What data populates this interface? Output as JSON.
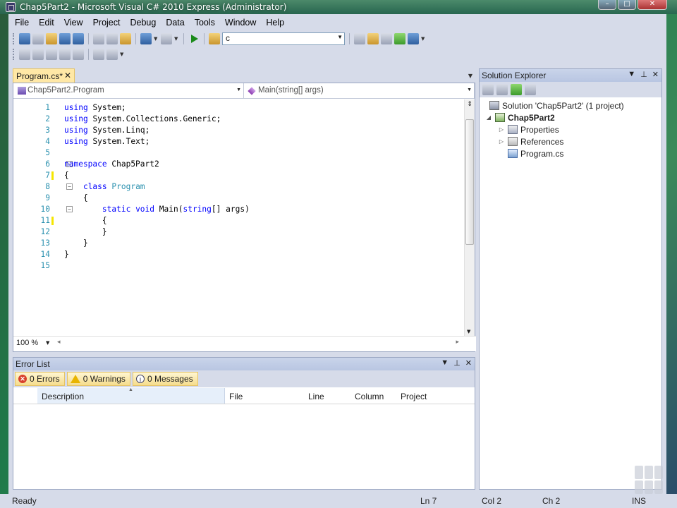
{
  "window": {
    "title": "Chap5Part2 - Microsoft Visual C# 2010 Express (Administrator)"
  },
  "menu": [
    "File",
    "Edit",
    "View",
    "Project",
    "Debug",
    "Data",
    "Tools",
    "Window",
    "Help"
  ],
  "toolbar": {
    "find_value": "c"
  },
  "editor": {
    "tab_label": "Program.cs*",
    "nav_type": "Chap5Part2.Program",
    "nav_member": "Main(string[] args)",
    "zoom": "100 %",
    "lines": [
      "using System;",
      "using System.Collections.Generic;",
      "using System.Linq;",
      "using System.Text;",
      "",
      "namespace Chap5Part2",
      "{",
      "    class Program",
      "    {",
      "        static void Main(string[] args)",
      "        {",
      "        }",
      "    }",
      "}",
      ""
    ],
    "line_numbers": [
      "1",
      "2",
      "3",
      "4",
      "5",
      "6",
      "7",
      "8",
      "9",
      "10",
      "11",
      "12",
      "13",
      "14",
      "15"
    ]
  },
  "error_list": {
    "title": "Error List",
    "errors": "0 Errors",
    "warnings": "0 Warnings",
    "messages": "0 Messages",
    "columns": [
      "Description",
      "File",
      "Line",
      "Column",
      "Project"
    ]
  },
  "solution_explorer": {
    "title": "Solution Explorer",
    "solution": "Solution 'Chap5Part2' (1 project)",
    "project": "Chap5Part2",
    "items": [
      "Properties",
      "References",
      "Program.cs"
    ]
  },
  "status": {
    "ready": "Ready",
    "ln": "Ln 7",
    "col": "Col 2",
    "ch": "Ch 2",
    "ins": "INS"
  }
}
